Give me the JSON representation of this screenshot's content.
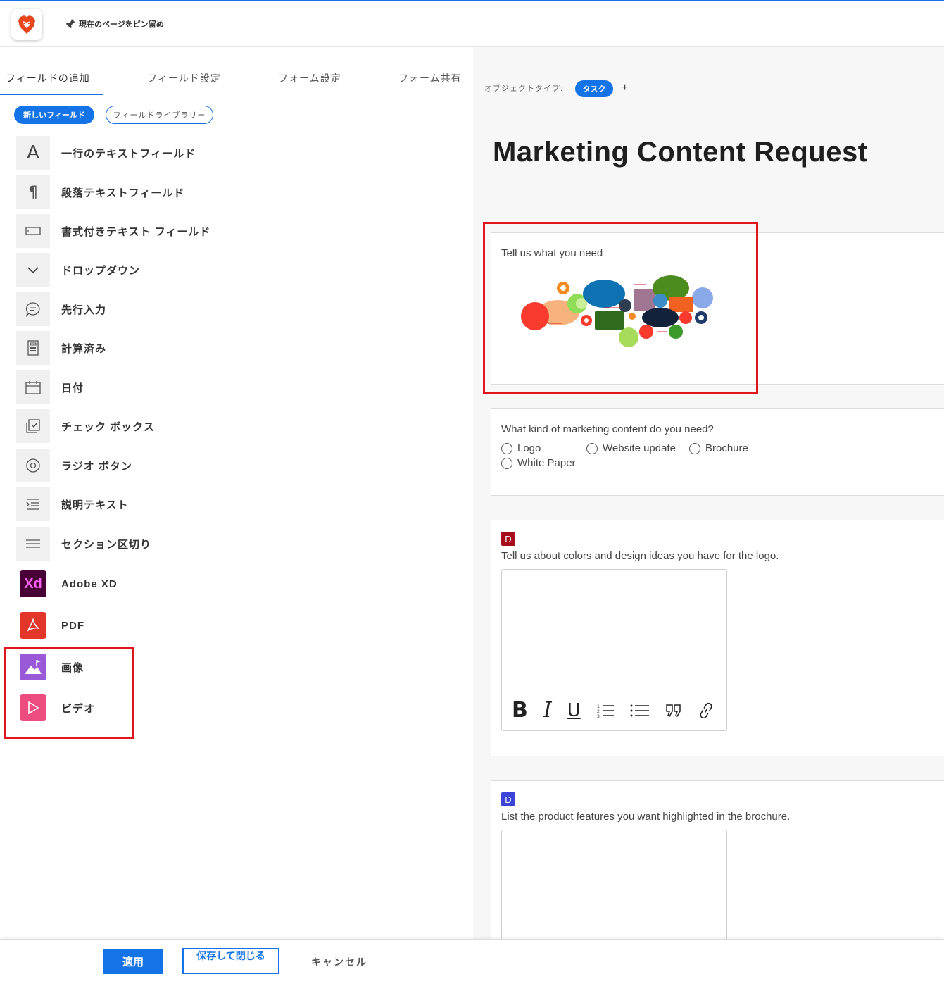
{
  "topbar": {
    "pin_label": "現在のページをピン留め"
  },
  "tabs": [
    "フィールドの追加",
    "フィールド設定",
    "フォーム設定",
    "フォーム共有"
  ],
  "pills": {
    "new_field": "新しいフィールド",
    "field_library": "フィールドライブラリー"
  },
  "fields": [
    {
      "label": "一行のテキストフィールド",
      "icon": "text-a-icon"
    },
    {
      "label": "段落テキストフィールド",
      "icon": "paragraph-icon"
    },
    {
      "label": "書式付きテキスト フィールド",
      "icon": "rich-text-icon"
    },
    {
      "label": "ドロップダウン",
      "icon": "chevron-down-icon"
    },
    {
      "label": "先行入力",
      "icon": "chat-bubble-icon"
    },
    {
      "label": "計算済み",
      "icon": "calculator-icon"
    },
    {
      "label": "日付",
      "icon": "calendar-icon"
    },
    {
      "label": "チェック ボックス",
      "icon": "checkbox-icon"
    },
    {
      "label": "ラジオ ボタン",
      "icon": "radio-icon"
    },
    {
      "label": "説明テキスト",
      "icon": "description-icon"
    },
    {
      "label": "セクション区切り",
      "icon": "section-break-icon"
    },
    {
      "label": "Adobe XD",
      "icon": "adobe-xd-icon"
    },
    {
      "label": "PDF",
      "icon": "pdf-icon"
    },
    {
      "label": "画像",
      "icon": "image-icon"
    },
    {
      "label": "ビデオ",
      "icon": "video-icon"
    }
  ],
  "form": {
    "object_type_label": "オブジェクトタイプ:",
    "object_type_value": "タスク",
    "plus": "+",
    "title": "Marketing Content Request",
    "q1": "Tell us what you need",
    "q2": "What kind of marketing content do you need?",
    "q2_options": [
      "Logo",
      "Website update",
      "Brochure",
      "White Paper"
    ],
    "q3_badge": "D",
    "q3": "Tell us about colors and design ideas you have for the logo.",
    "q4_badge": "D",
    "q4": "List the product features you want highlighted in the brochure."
  },
  "colors": {
    "accent": "#1473e6",
    "highlight": "#e1151d",
    "badge_red": "#a50d1c",
    "badge_blue": "#3c44d8"
  },
  "footer": {
    "apply": "適用",
    "save_close": "保存して閉じる",
    "cancel": "キャンセル"
  }
}
